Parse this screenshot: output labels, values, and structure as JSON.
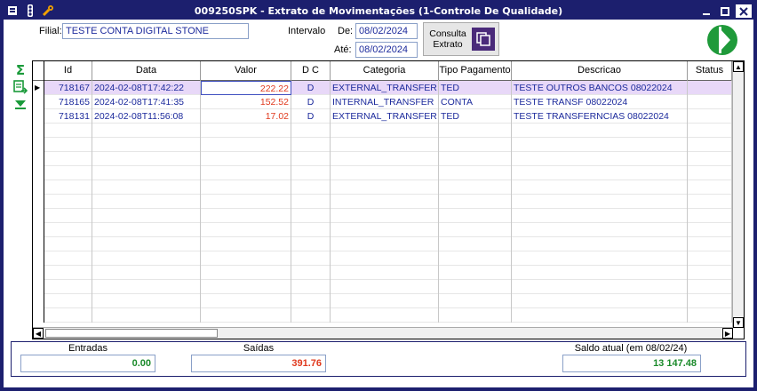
{
  "window": {
    "title": "009250SPK - Extrato de Movimentações (1-Controle De Qualidade)"
  },
  "filter": {
    "filial_label": "Filial:",
    "filial_value": "TESTE CONTA DIGITAL STONE",
    "intervalo_label": "Intervalo",
    "de_label": "De:",
    "de_value": "08/02/2024",
    "ate_label": "Até:",
    "ate_value": "08/02/2024",
    "consulta_label_1": "Consulta",
    "consulta_label_2": "Extrato"
  },
  "grid": {
    "columns": [
      "Id",
      "Data",
      "Valor",
      "D C",
      "Categoria",
      "Tipo Pagamento",
      "Descricao",
      "Status"
    ],
    "rows": [
      {
        "id": "718167",
        "data": "2024-02-08T17:42:22",
        "valor": "222.22",
        "dc": "D",
        "categoria": "EXTERNAL_TRANSFER",
        "tipo": "TED",
        "descricao": "TESTE OUTROS BANCOS 08022024",
        "status": ""
      },
      {
        "id": "718165",
        "data": "2024-02-08T17:41:35",
        "valor": "152.52",
        "dc": "D",
        "categoria": "INTERNAL_TRANSFER",
        "tipo": "CONTA",
        "descricao": "TESTE TRANSF 08022024",
        "status": ""
      },
      {
        "id": "718131",
        "data": "2024-02-08T11:56:08",
        "valor": "17.02",
        "dc": "D",
        "categoria": "EXTERNAL_TRANSFER",
        "tipo": "TED",
        "descricao": "TESTE TRANSFERNCIAS 08022024",
        "status": ""
      }
    ],
    "selected_row": 0
  },
  "totals": {
    "entradas_label": "Entradas",
    "entradas_value": "0.00",
    "saidas_label": "Saídas",
    "saidas_value": "391.76",
    "saldo_label": "Saldo atual (em 08/02/24)",
    "saldo_value": "13 147.48"
  },
  "colors": {
    "titlebar": "#1c1f6e",
    "positive": "#1a8a2a",
    "negative": "#e0391d",
    "text_blue": "#1c2a9c"
  }
}
